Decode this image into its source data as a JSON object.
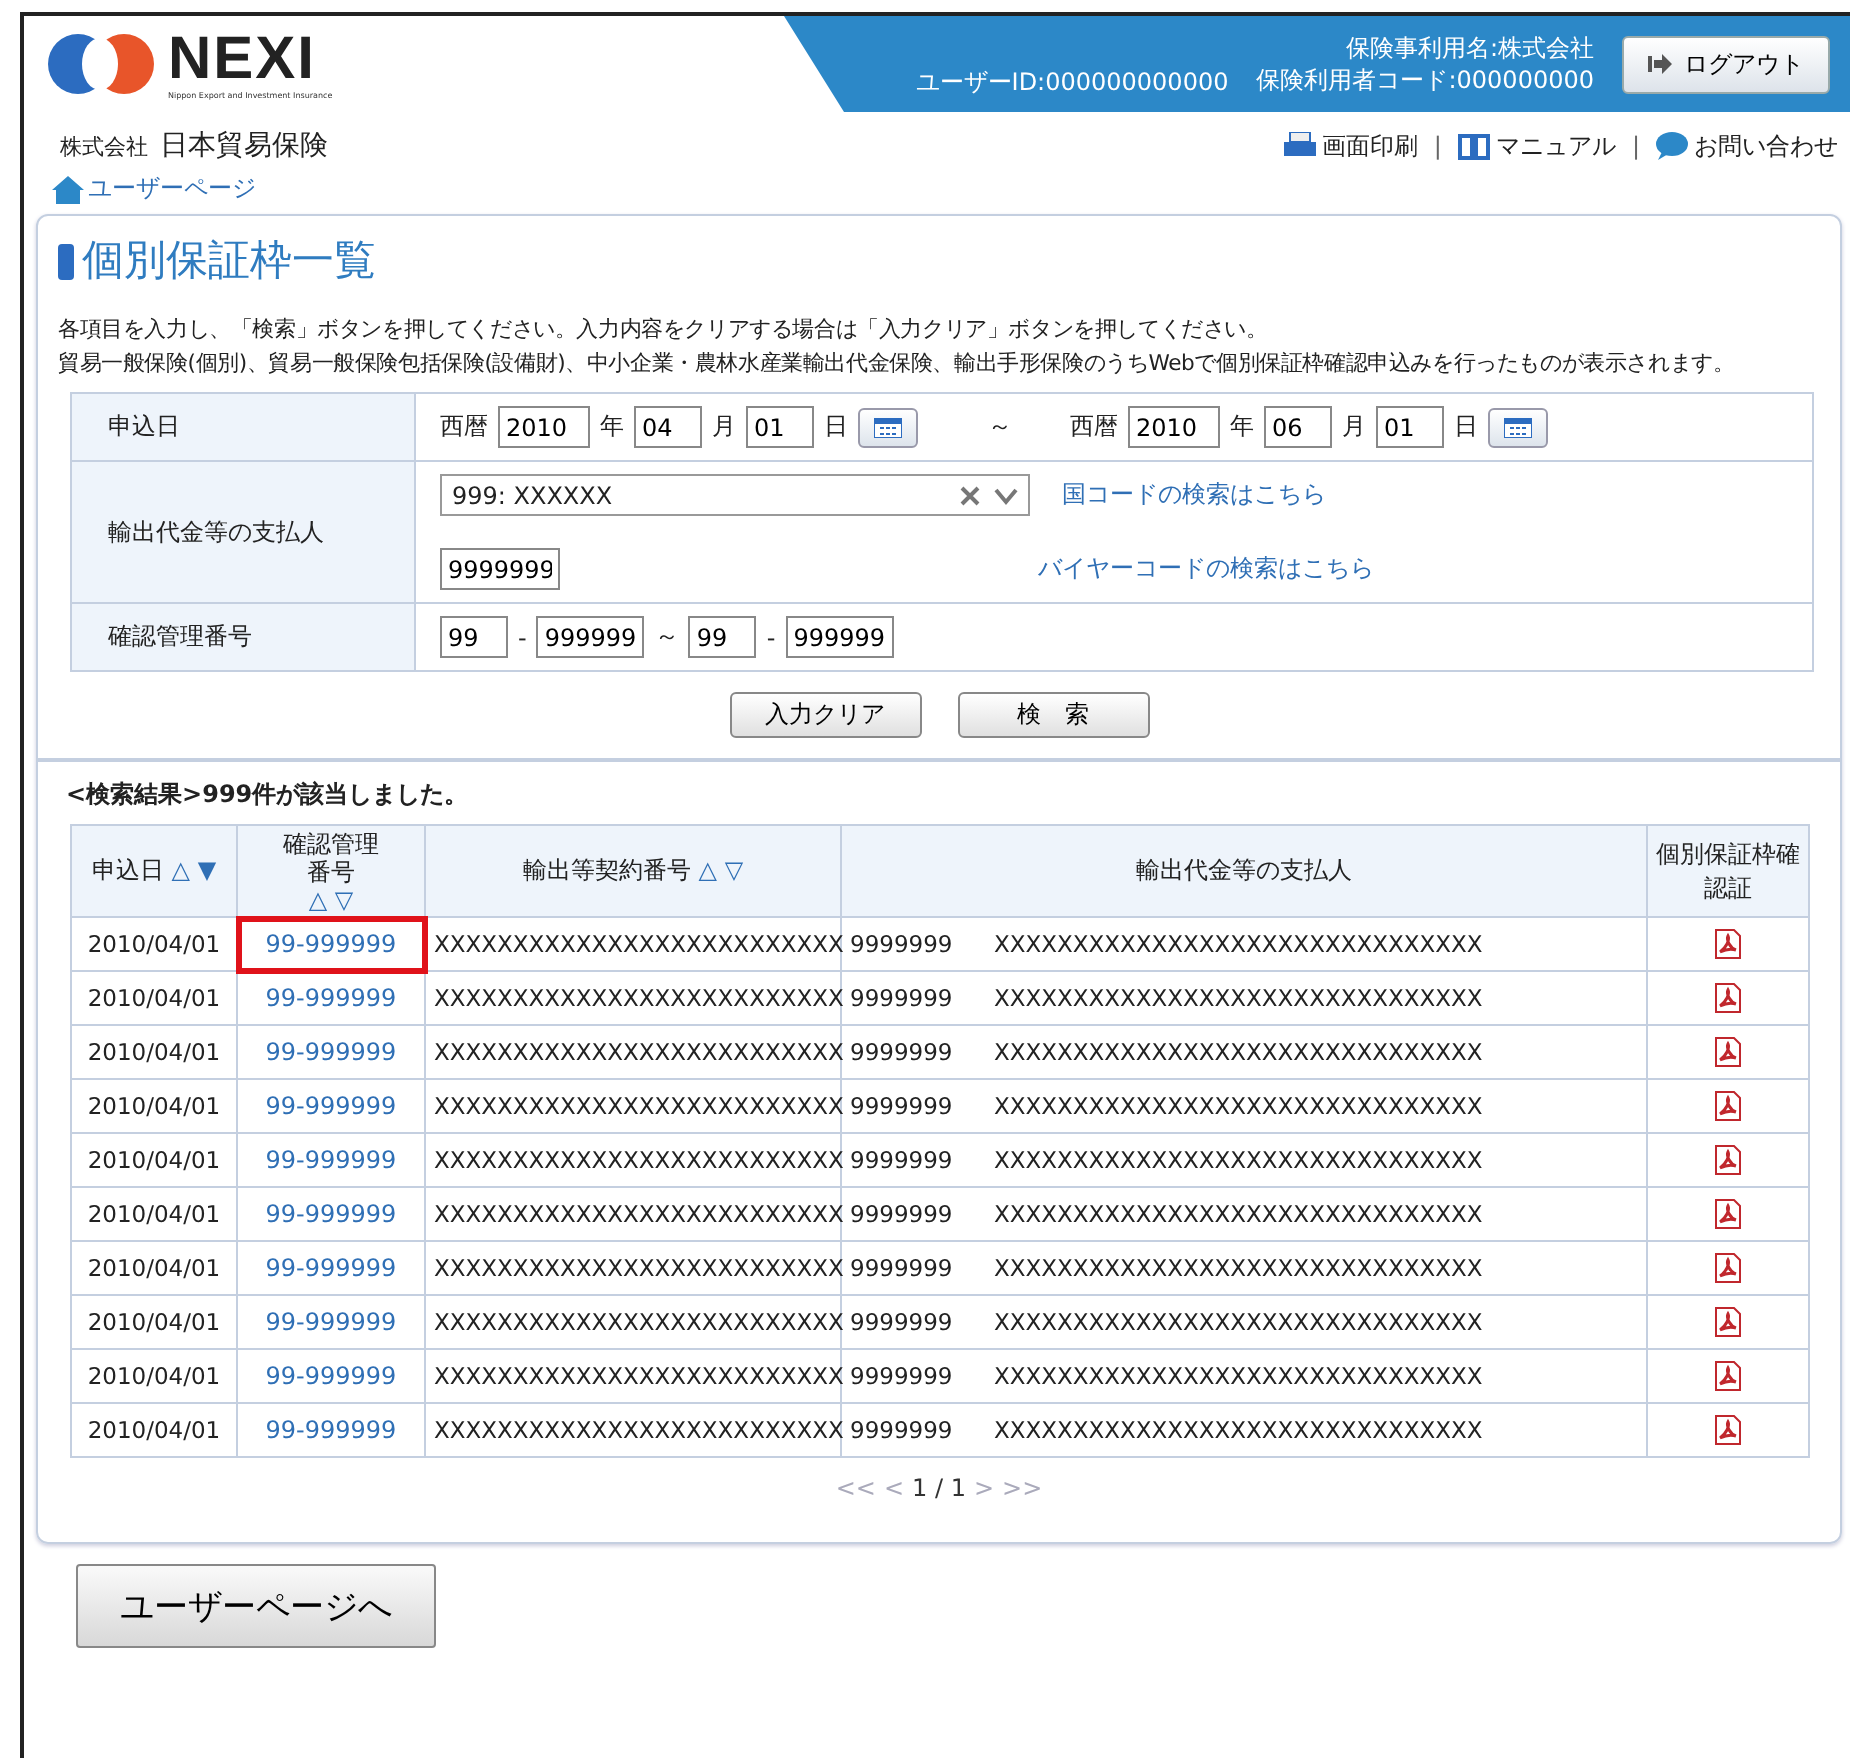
{
  "header": {
    "logo_text": "NEXI",
    "logo_subtitle": "Nippon Export and Investment Insurance",
    "user_id": "ユーザーID:000000000000",
    "user_name": "保険事利用名:株式会社",
    "user_code": "保険利用者コード:000000000",
    "logout": "ログアウト",
    "company_prefix": "株式会社",
    "company": "日本貿易保険",
    "tools": [
      {
        "kind": "print",
        "label": "画面印刷"
      },
      {
        "kind": "manual",
        "label": "マニュアル",
        "separator": "|"
      },
      {
        "kind": "contact",
        "label": "お問い合わせ",
        "separator": "|"
      }
    ],
    "breadcrumb": "ユーザーページ"
  },
  "panel": {
    "title": "個別保証枠一覧",
    "description": [
      "各項目を入力し、「検索」ボタンを押してください。入力内容をクリアする場合は「入力クリア」ボタンを押してください。",
      "貿易一般保険(個別)、貿易一般保険包括保険(設備財)、中小企業・農林水産業輸出代金保険、輸出手形保険のうちWebで個別保証枠確認申込みを行ったものが表示されます。"
    ],
    "form": {
      "date_label": "申込日",
      "from": {
        "era": "西暦",
        "year": "2010",
        "year_unit": "年",
        "month": "04",
        "month_unit": "月",
        "day": "01",
        "day_unit": "日"
      },
      "range_sep": "～",
      "to": {
        "era": "西暦",
        "year": "2010",
        "year_unit": "年",
        "month": "06",
        "month_unit": "月",
        "day": "01",
        "day_unit": "日"
      },
      "payer_label": "輸出代金等の支払人",
      "country_value": "999: XXXXXX",
      "country_link": "国コードの検索はこちら",
      "buyer_value": "9999999",
      "buyer_link": "バイヤーコードの検索はこちら",
      "number_label": "確認管理番号",
      "number_from": [
        "99",
        "999999"
      ],
      "number_sep": "～",
      "number_to": [
        "99",
        "999999"
      ],
      "dash_from": "-",
      "dash_to": "-"
    },
    "buttons": [
      "入力クリア",
      "検　索"
    ],
    "result_summary": "<検索結果>999件が該当しました。",
    "table": {
      "columns": [
        {
          "label": "申込日",
          "sort_up": "△",
          "sort_down": "▼"
        },
        {
          "label": "確認管理番号",
          "sort_up": "△",
          "sort_down": "▽"
        },
        {
          "label": "輸出等契約番号",
          "sort_up": "△",
          "sort_down": "▽"
        },
        {
          "label": "輸出代金等の支払人"
        },
        {
          "label": "個別保証枠確認証"
        }
      ],
      "rows": [
        {
          "date": "2010/04/01",
          "number": "99-999999",
          "contract": "XXXXXXXXXXXXXXXXXXXXXXXXXX",
          "payer_code": "9999999",
          "payer_name": "XXXXXXXXXXXXXXXXXXXXXXXXXXXXXXX",
          "highlighted": true
        },
        {
          "date": "2010/04/01",
          "number": "99-999999",
          "contract": "XXXXXXXXXXXXXXXXXXXXXXXXXX",
          "payer_code": "9999999",
          "payer_name": "XXXXXXXXXXXXXXXXXXXXXXXXXXXXXXX",
          "highlighted": false
        },
        {
          "date": "2010/04/01",
          "number": "99-999999",
          "contract": "XXXXXXXXXXXXXXXXXXXXXXXXXX",
          "payer_code": "9999999",
          "payer_name": "XXXXXXXXXXXXXXXXXXXXXXXXXXXXXXX",
          "highlighted": false
        },
        {
          "date": "2010/04/01",
          "number": "99-999999",
          "contract": "XXXXXXXXXXXXXXXXXXXXXXXXXX",
          "payer_code": "9999999",
          "payer_name": "XXXXXXXXXXXXXXXXXXXXXXXXXXXXXXX",
          "highlighted": false
        },
        {
          "date": "2010/04/01",
          "number": "99-999999",
          "contract": "XXXXXXXXXXXXXXXXXXXXXXXXXX",
          "payer_code": "9999999",
          "payer_name": "XXXXXXXXXXXXXXXXXXXXXXXXXXXXXXX",
          "highlighted": false
        },
        {
          "date": "2010/04/01",
          "number": "99-999999",
          "contract": "XXXXXXXXXXXXXXXXXXXXXXXXXX",
          "payer_code": "9999999",
          "payer_name": "XXXXXXXXXXXXXXXXXXXXXXXXXXXXXXX",
          "highlighted": false
        },
        {
          "date": "2010/04/01",
          "number": "99-999999",
          "contract": "XXXXXXXXXXXXXXXXXXXXXXXXXX",
          "payer_code": "9999999",
          "payer_name": "XXXXXXXXXXXXXXXXXXXXXXXXXXXXXXX",
          "highlighted": false
        },
        {
          "date": "2010/04/01",
          "number": "99-999999",
          "contract": "XXXXXXXXXXXXXXXXXXXXXXXXXX",
          "payer_code": "9999999",
          "payer_name": "XXXXXXXXXXXXXXXXXXXXXXXXXXXXXXX",
          "highlighted": false
        },
        {
          "date": "2010/04/01",
          "number": "99-999999",
          "contract": "XXXXXXXXXXXXXXXXXXXXXXXXXX",
          "payer_code": "9999999",
          "payer_name": "XXXXXXXXXXXXXXXXXXXXXXXXXXXXXXX",
          "highlighted": false
        },
        {
          "date": "2010/04/01",
          "number": "99-999999",
          "contract": "XXXXXXXXXXXXXXXXXXXXXXXXXX",
          "payer_code": "9999999",
          "payer_name": "XXXXXXXXXXXXXXXXXXXXXXXXXXXXXXX",
          "highlighted": false
        }
      ]
    },
    "pager": {
      "first": "<<",
      "prev": "<",
      "current": "1 / 1",
      "next": ">",
      "last": ">>"
    }
  },
  "back_button": "ユーザーページへ"
}
